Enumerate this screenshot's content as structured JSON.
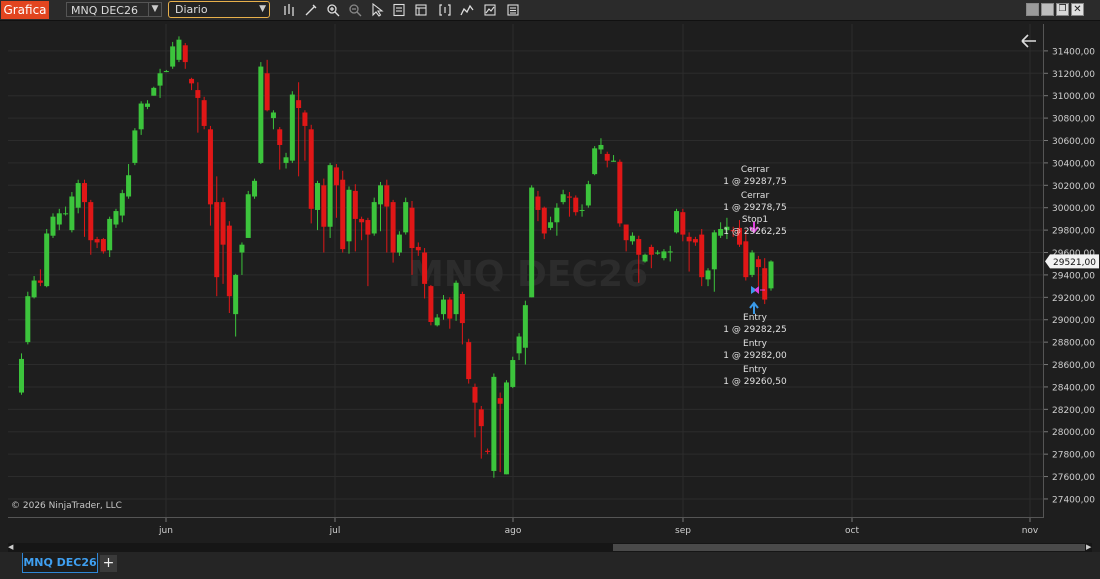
{
  "toolbar": {
    "app_label": "Grafica",
    "instrument": "MNQ DEC26",
    "period": "Diario",
    "tools": [
      "bar-type-icon",
      "pencil-icon",
      "zoom-in-icon",
      "zoom-out-icon",
      "pointer-icon",
      "data-box-icon",
      "properties-icon",
      "bracket-icon",
      "strategies-icon",
      "indicators-icon",
      "templates-icon"
    ]
  },
  "window_controls": [
    "minimize-icon",
    "restore-icon",
    "float-icon",
    "close-icon"
  ],
  "chart": {
    "watermark": "MNQ DEC26",
    "copyright": "© 2026 NinjaTrader, LLC",
    "last_price": "29521,00",
    "colors": {
      "up": "#3cc43c",
      "down": "#e01717",
      "bg": "#1e1e1e",
      "grid": "#2c2c2c"
    }
  },
  "chart_data": {
    "type": "candlestick",
    "ylim": [
      27230,
      31640
    ],
    "y_ticks": [
      "31400,00",
      "31200,00",
      "31000,00",
      "30800,00",
      "30600,00",
      "30400,00",
      "30200,00",
      "30000,00",
      "29800,00",
      "29600,00",
      "29400,00",
      "29200,00",
      "29000,00",
      "28800,00",
      "28600,00",
      "28400,00",
      "28200,00",
      "28000,00",
      "27800,00",
      "27600,00",
      "27400,00"
    ],
    "x_ticks": [
      "jun",
      "jul",
      "ago",
      "sep",
      "oct",
      "nov"
    ],
    "candles": [
      [
        28350,
        28650,
        28330,
        28700
      ],
      [
        28800,
        29210,
        28780,
        29250
      ],
      [
        29200,
        29350,
        29190,
        29390
      ],
      [
        29350,
        29330,
        29300,
        29450
      ],
      [
        29300,
        29770,
        29290,
        29810
      ],
      [
        29750,
        29920,
        29730,
        29950
      ],
      [
        29850,
        29950,
        29800,
        29990
      ],
      [
        29950,
        29950,
        29930,
        30010
      ],
      [
        29800,
        30100,
        29780,
        30140
      ],
      [
        30000,
        30220,
        29950,
        30250
      ],
      [
        30220,
        30050,
        29740,
        30250
      ],
      [
        30050,
        29710,
        29580,
        30070
      ],
      [
        29720,
        29690,
        29640,
        29740
      ],
      [
        29720,
        29610,
        29590,
        29730
      ],
      [
        29620,
        29900,
        29560,
        29920
      ],
      [
        29850,
        29970,
        29820,
        29990
      ],
      [
        29930,
        30130,
        29870,
        30160
      ],
      [
        30100,
        30290,
        30080,
        30390
      ],
      [
        30400,
        30690,
        30380,
        30710
      ],
      [
        30700,
        30930,
        30650,
        30950
      ],
      [
        30900,
        30930,
        30880,
        30960
      ],
      [
        31000,
        31070,
        31000,
        31080
      ],
      [
        31090,
        31200,
        30980,
        31240
      ],
      [
        31220,
        31220,
        31210,
        31230
      ],
      [
        31260,
        31440,
        31240,
        31480
      ],
      [
        31320,
        31500,
        31300,
        31530
      ],
      [
        31450,
        31300,
        31240,
        31470
      ],
      [
        31150,
        31110,
        31050,
        31160
      ],
      [
        31050,
        30980,
        30670,
        31120
      ],
      [
        30960,
        30730,
        30700,
        30990
      ],
      [
        30700,
        30030,
        29840,
        30730
      ],
      [
        30050,
        29380,
        29210,
        30280
      ],
      [
        30050,
        29670,
        29320,
        30090
      ],
      [
        29840,
        29210,
        29060,
        29880
      ],
      [
        29050,
        29400,
        28850,
        29410
      ],
      [
        29600,
        29670,
        29400,
        29690
      ],
      [
        29730,
        30120,
        29960,
        30150
      ],
      [
        30100,
        30240,
        30080,
        30260
      ],
      [
        30400,
        31260,
        30390,
        31300
      ],
      [
        31200,
        30870,
        30860,
        31320
      ],
      [
        30800,
        30850,
        30700,
        30870
      ],
      [
        30700,
        30560,
        30340,
        30720
      ],
      [
        30400,
        30450,
        30350,
        30490
      ],
      [
        30420,
        31010,
        30400,
        31040
      ],
      [
        30960,
        30890,
        30280,
        31120
      ],
      [
        30850,
        30730,
        30420,
        30870
      ],
      [
        30700,
        29990,
        29860,
        30740
      ],
      [
        29980,
        30220,
        29800,
        30240
      ],
      [
        30200,
        29830,
        29600,
        30260
      ],
      [
        29830,
        30380,
        29730,
        30400
      ],
      [
        30360,
        30200,
        29910,
        30390
      ],
      [
        30250,
        29630,
        29600,
        30330
      ],
      [
        29700,
        30160,
        29590,
        30190
      ],
      [
        30150,
        29900,
        29610,
        30210
      ],
      [
        29900,
        29870,
        29710,
        29920
      ],
      [
        29890,
        29760,
        29300,
        29910
      ],
      [
        29770,
        30050,
        29750,
        30090
      ],
      [
        30030,
        30200,
        29790,
        30230
      ],
      [
        30200,
        30010,
        29600,
        30250
      ],
      [
        30050,
        29600,
        29510,
        30070
      ],
      [
        29600,
        29760,
        29570,
        29790
      ],
      [
        29780,
        30050,
        29760,
        30090
      ],
      [
        30000,
        29640,
        29400,
        30060
      ],
      [
        29650,
        29620,
        29570,
        29690
      ],
      [
        29600,
        29320,
        29190,
        29640
      ],
      [
        29300,
        28980,
        28950,
        29310
      ],
      [
        28950,
        29020,
        28940,
        29050
      ],
      [
        29050,
        29180,
        29000,
        29220
      ],
      [
        29180,
        29010,
        28920,
        29200
      ],
      [
        29050,
        29330,
        28990,
        29350
      ],
      [
        29230,
        28970,
        28780,
        29250
      ],
      [
        28800,
        28470,
        28430,
        28830
      ],
      [
        28400,
        28260,
        27950,
        28430
      ],
      [
        28200,
        28050,
        27760,
        28230
      ],
      [
        27830,
        27820,
        27800,
        27850
      ],
      [
        27650,
        28490,
        27590,
        28520
      ],
      [
        28300,
        28250,
        27640,
        28350
      ],
      [
        27620,
        28440,
        27620,
        28460
      ],
      [
        28400,
        28640,
        28390,
        28670
      ],
      [
        28700,
        28850,
        28640,
        28880
      ],
      [
        28750,
        29130,
        28600,
        29170
      ],
      [
        29200,
        30180,
        29200,
        30200
      ],
      [
        30100,
        29980,
        29880,
        30150
      ],
      [
        30000,
        29770,
        29720,
        30010
      ],
      [
        29820,
        29870,
        29800,
        29920
      ],
      [
        29870,
        30000,
        29750,
        30040
      ],
      [
        30050,
        30120,
        30030,
        30160
      ],
      [
        30100,
        30090,
        29920,
        30140
      ],
      [
        30090,
        29960,
        29930,
        30110
      ],
      [
        29980,
        29980,
        29920,
        30030
      ],
      [
        30020,
        30210,
        30000,
        30240
      ],
      [
        30300,
        30530,
        30290,
        30550
      ],
      [
        30520,
        30560,
        30480,
        30620
      ],
      [
        30480,
        30420,
        30360,
        30500
      ],
      [
        30410,
        30420,
        30410,
        30470
      ],
      [
        30410,
        29860,
        29830,
        30430
      ],
      [
        29850,
        29710,
        29610,
        29850
      ],
      [
        29700,
        29750,
        29670,
        29780
      ],
      [
        29720,
        29580,
        29330,
        29750
      ],
      [
        29520,
        29580,
        29510,
        29590
      ],
      [
        29650,
        29580,
        29460,
        29670
      ],
      [
        29590,
        29600,
        29580,
        29620
      ],
      [
        29550,
        29610,
        29530,
        29630
      ],
      [
        29600,
        29610,
        29520,
        29660
      ],
      [
        29780,
        29970,
        29770,
        29990
      ],
      [
        29960,
        29760,
        29700,
        29990
      ],
      [
        29740,
        29700,
        29430,
        29780
      ],
      [
        29720,
        29690,
        29660,
        29740
      ],
      [
        29760,
        29380,
        29300,
        29810
      ],
      [
        29360,
        29440,
        29300,
        29460
      ],
      [
        29450,
        29780,
        29250,
        29800
      ],
      [
        29750,
        29810,
        29730,
        29870
      ],
      [
        29800,
        29830,
        29720,
        29910
      ],
      [
        29800,
        29790,
        29740,
        29830
      ],
      [
        29820,
        29670,
        29650,
        29890
      ],
      [
        29700,
        29380,
        29350,
        29800
      ],
      [
        29400,
        29600,
        29380,
        29620
      ],
      [
        29540,
        29470,
        29300,
        29570
      ],
      [
        29460,
        29180,
        29140,
        29550
      ],
      [
        29280,
        29520,
        29260,
        29530
      ]
    ],
    "orders": [
      {
        "name": "Cerrar",
        "detail": "1 @ 29287,75"
      },
      {
        "name": "Cerrar",
        "detail": "1 @ 29278,75"
      },
      {
        "name": "Stop1",
        "detail": "1 @ 29262,25"
      },
      {
        "name": "Entry",
        "detail": "1 @ 29282,25"
      },
      {
        "name": "Entry",
        "detail": "1 @ 29282,00"
      },
      {
        "name": "Entry",
        "detail": "1 @ 29260,50"
      }
    ]
  },
  "tabs": {
    "active": "MNQ DEC26",
    "add_label": "+"
  }
}
